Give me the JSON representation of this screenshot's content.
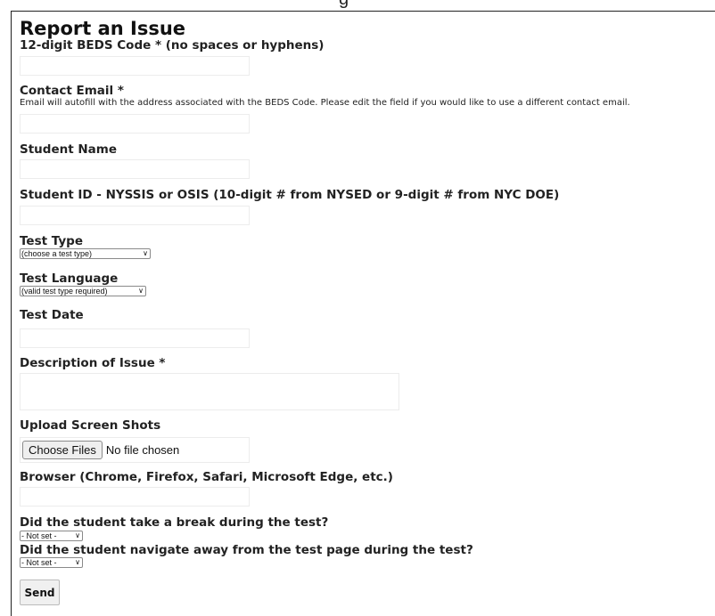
{
  "page": {
    "title": "Report an Issue",
    "top_fragment": "g"
  },
  "fields": {
    "beds": {
      "label": "12-digit BEDS Code * (no spaces or hyphens)",
      "value": ""
    },
    "email": {
      "label": "Contact Email *",
      "help": "Email will autofill with the address associated with the BEDS Code. Please edit the field if you would like to use a different contact email.",
      "value": ""
    },
    "student_name": {
      "label": "Student Name",
      "value": ""
    },
    "student_id": {
      "label": "Student ID - NYSSIS or OSIS (10-digit # from NYSED or 9-digit # from NYC DOE)",
      "value": ""
    },
    "test_type": {
      "label": "Test Type",
      "selected": "(choose a test type)"
    },
    "test_language": {
      "label": "Test Language",
      "selected": "(valid test type required)"
    },
    "test_date": {
      "label": "Test Date",
      "value": ""
    },
    "description": {
      "label": "Description of Issue *",
      "value": ""
    },
    "upload": {
      "label": "Upload Screen Shots",
      "button": "Choose Files",
      "status": "No file chosen"
    },
    "browser": {
      "label": "Browser (Chrome, Firefox, Safari, Microsoft Edge, etc.)",
      "value": ""
    },
    "break": {
      "label": "Did the student take a break during the test?",
      "selected": "- Not set -"
    },
    "navigate": {
      "label": "Did the student navigate away from the test page during the test?",
      "selected": "- Not set -"
    }
  },
  "actions": {
    "send": "Send"
  }
}
